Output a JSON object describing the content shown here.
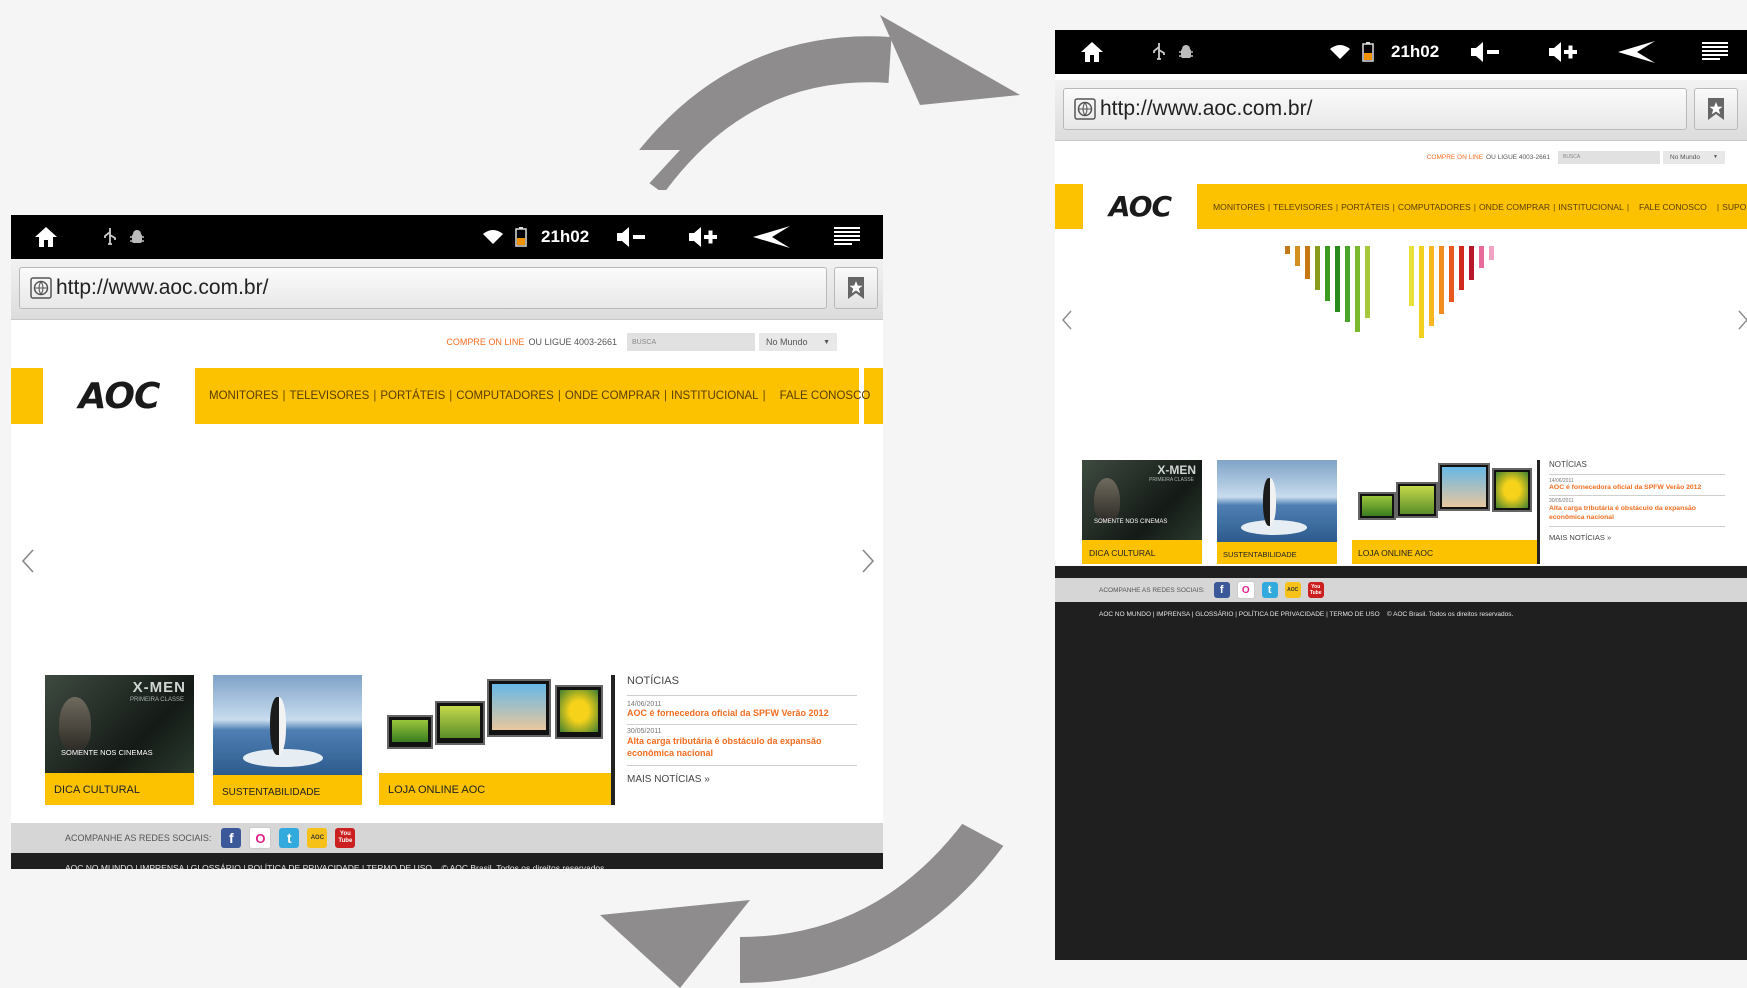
{
  "device": {
    "time": "21h02",
    "url": "http://www.aoc.com.br/",
    "icons": [
      "home-icon",
      "usb-icon",
      "android-debug-icon",
      "wifi-icon",
      "battery-icon",
      "volume-down-icon",
      "volume-up-icon",
      "back-icon",
      "menu-icon",
      "bookmark-icon",
      "globe-icon"
    ]
  },
  "site": {
    "buy_online": "COMPRE ON LINE",
    "call_text": "OU LIGUE 4003-2661",
    "search_placeholder": "BUSCA",
    "region": "No Mundo",
    "logo": "AOC",
    "nav": [
      {
        "label": "MONITORES"
      },
      {
        "label": "TELEVISORES"
      },
      {
        "label": "PORTÁTEIS"
      },
      {
        "label": "COMPUTADORES"
      },
      {
        "label": "ONDE COMPRAR"
      },
      {
        "label": "INSTITUCIONAL"
      },
      {
        "label": "FALE CONOSCO"
      },
      {
        "label": "SUPORTE"
      }
    ],
    "tiles": [
      {
        "caption": "DICA CULTURAL",
        "banner_title": "X-MEN",
        "banner_sub": "PRIMEIRA CLASSE",
        "banner_text": "SOMENTE NOS CINEMAS"
      },
      {
        "caption": "SUSTENTABILIDADE"
      },
      {
        "caption": "LOJA ONLINE AOC"
      }
    ],
    "news": {
      "title": "NOTÍCIAS",
      "items": [
        {
          "date": "14/06/2011",
          "headline": "AOC é fornecedora oficial da SPFW Verão 2012"
        },
        {
          "date": "30/05/2011",
          "headline": "Alta carga tributária é obstáculo da expansão econômica nacional"
        }
      ],
      "more": "MAIS NOTÍCIAS"
    },
    "social_label": "ACOMPANHE AS REDES SOCIAIS:",
    "social_icons": [
      {
        "name": "facebook-icon",
        "glyph": "f",
        "color": "#3b5998"
      },
      {
        "name": "orkut-icon",
        "glyph": "O",
        "color": "#e0218a"
      },
      {
        "name": "twitter-icon",
        "glyph": "t",
        "color": "#33aadd"
      },
      {
        "name": "aoc-blog-icon",
        "glyph": "AOC",
        "color": "#f6c21a"
      },
      {
        "name": "youtube-icon",
        "glyph": "You Tube",
        "color": "#cc1f1f"
      }
    ],
    "footer": "AOC NO MUNDO | IMPRENSA | GLOSSÁRIO | POLÍTICA DE PRIVACIDADE | TERMO DE USO    © AOC Brasil. Todos os direitos reservados."
  },
  "colors": {
    "brand_yellow": "#fcc200",
    "accent_orange": "#f26d21",
    "cycle_arrow": "#8e8c8c"
  }
}
